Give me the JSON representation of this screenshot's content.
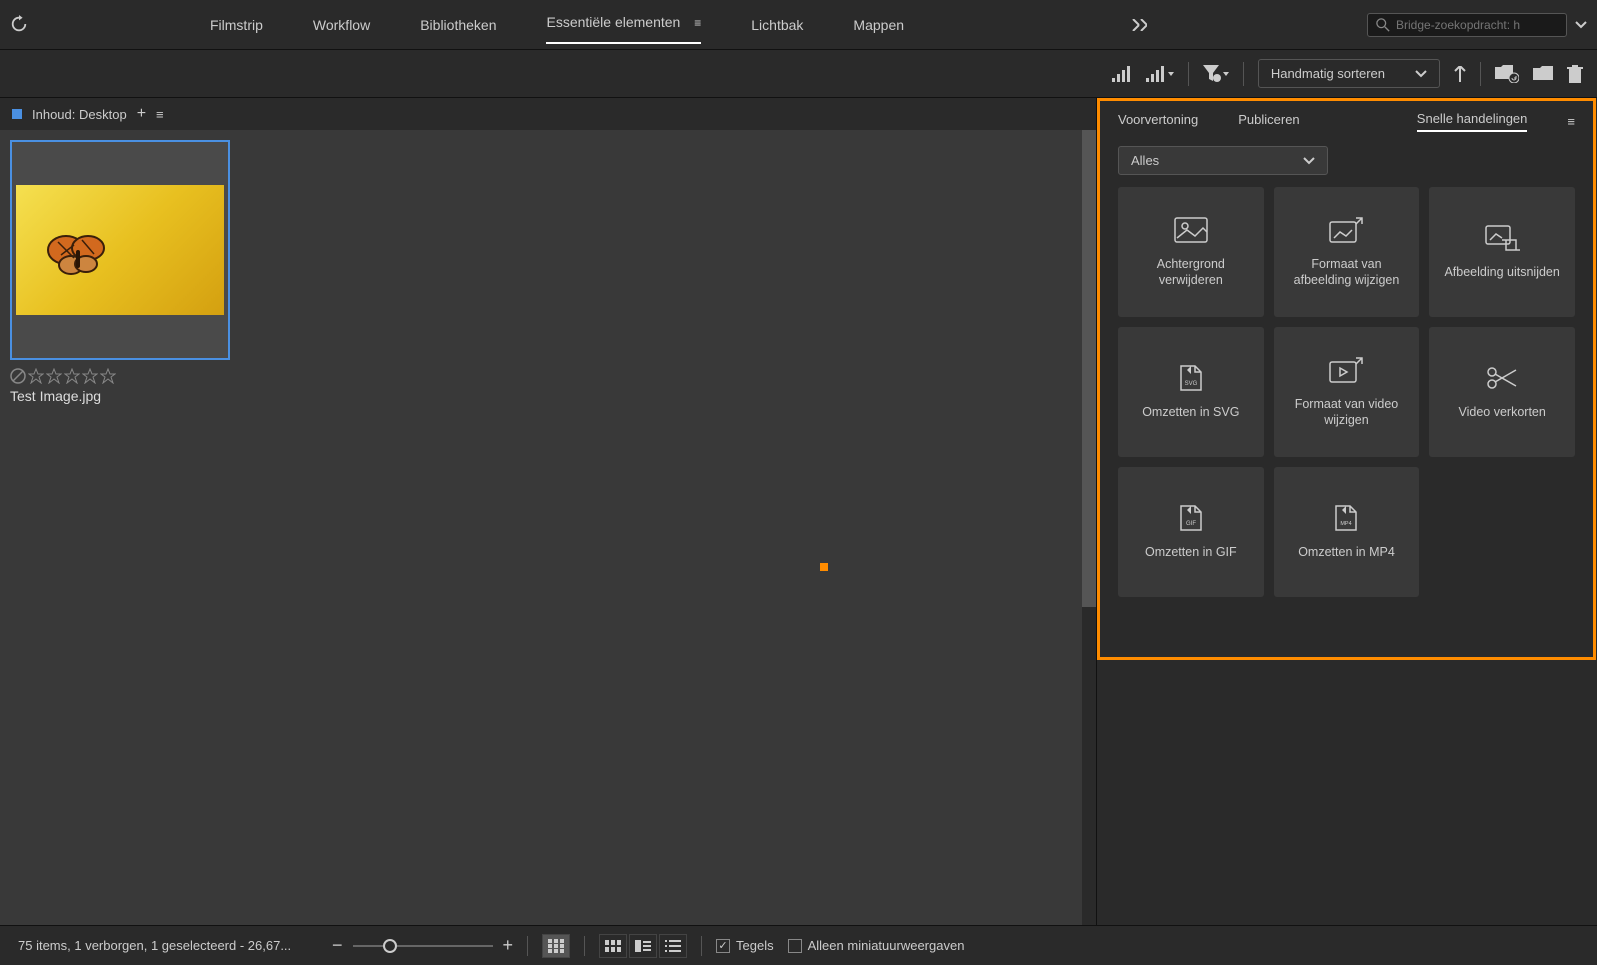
{
  "nav": {
    "tabs": [
      "Filmstrip",
      "Workflow",
      "Bibliotheken",
      "Essentiële elementen",
      "Lichtbak",
      "Mappen"
    ],
    "active_index": 3
  },
  "search": {
    "placeholder": "Bridge-zoekopdracht: h"
  },
  "toolbar": {
    "sort_label": "Handmatig sorteren"
  },
  "content": {
    "header_label": "Inhoud: Desktop",
    "filename": "Test Image.jpg"
  },
  "side": {
    "tabs": [
      "Voorvertoning",
      "Publiceren",
      "Snelle handelingen"
    ],
    "active_index": 2,
    "filter_value": "Alles",
    "actions": [
      {
        "label": "Achtergrond verwijderen",
        "icon": "bg-remove"
      },
      {
        "label": "Formaat van afbeelding wijzigen",
        "icon": "img-resize"
      },
      {
        "label": "Afbeelding uitsnijden",
        "icon": "img-crop"
      },
      {
        "label": "Omzetten in SVG",
        "icon": "to-svg"
      },
      {
        "label": "Formaat van video wijzigen",
        "icon": "vid-resize"
      },
      {
        "label": "Video verkorten",
        "icon": "vid-trim"
      },
      {
        "label": "Omzetten in GIF",
        "icon": "to-gif"
      },
      {
        "label": "Omzetten in MP4",
        "icon": "to-mp4"
      }
    ]
  },
  "footer": {
    "status": "75 items, 1 verborgen, 1 geselecteerd - 26,67...",
    "tiles_label": "Tegels",
    "thumb_only_label": "Alleen miniatuurweergaven"
  },
  "colors": {
    "highlight": "#ff8c00",
    "selection": "#4a90e2"
  }
}
